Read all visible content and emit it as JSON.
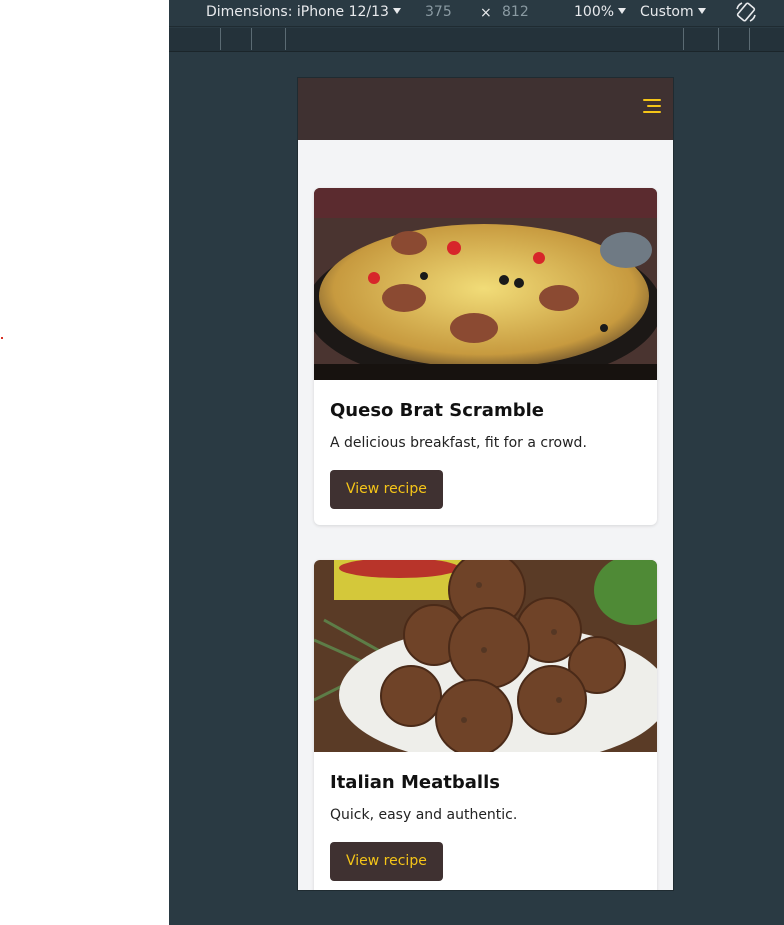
{
  "devtools": {
    "dimensions_label": "Dimensions: iPhone 12/13",
    "width": "375",
    "times": "×",
    "height": "812",
    "zoom": "100%",
    "throttle": "Custom",
    "icons": [
      "chevron-down-icon",
      "rotate-icon"
    ]
  },
  "app": {
    "header_color": "#3f3131",
    "accent_color": "#f5c518",
    "menu_icon": "hamburger-menu-icon",
    "cards": [
      {
        "title": "Queso Brat Scramble",
        "description": "A delicious breakfast, fit for a crowd.",
        "button": "View recipe",
        "image": "queso-brat-scramble-photo"
      },
      {
        "title": "Italian Meatballs",
        "description": "Quick, easy and authentic.",
        "button": "View recipe",
        "image": "italian-meatballs-photo"
      }
    ]
  }
}
